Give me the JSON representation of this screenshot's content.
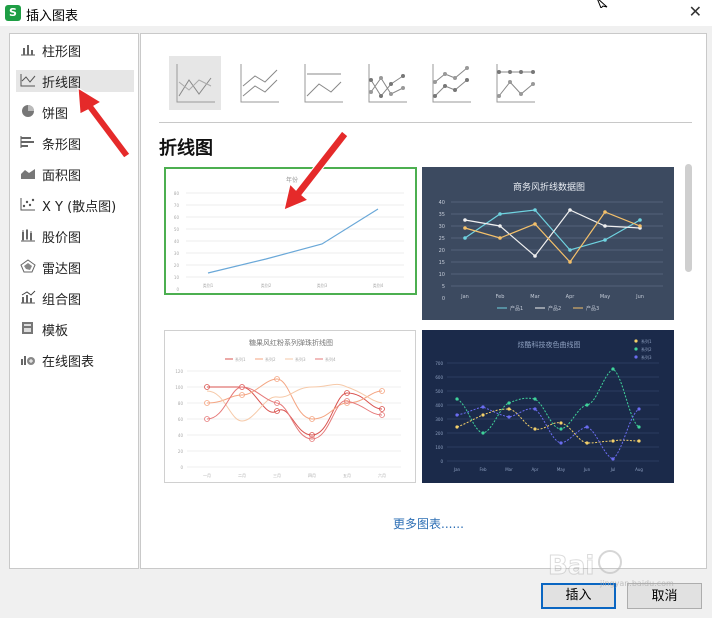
{
  "window": {
    "title": "插入图表",
    "app_icon_letter": "S"
  },
  "sidebar": {
    "items": [
      {
        "label": "柱形图",
        "icon": "column-chart-icon"
      },
      {
        "label": "折线图",
        "icon": "line-chart-icon",
        "active": true
      },
      {
        "label": "饼图",
        "icon": "pie-chart-icon"
      },
      {
        "label": "条形图",
        "icon": "bar-chart-icon"
      },
      {
        "label": "面积图",
        "icon": "area-chart-icon"
      },
      {
        "label": "X Y (散点图)",
        "icon": "scatter-chart-icon"
      },
      {
        "label": "股价图",
        "icon": "stock-chart-icon"
      },
      {
        "label": "雷达图",
        "icon": "radar-chart-icon"
      },
      {
        "label": "组合图",
        "icon": "combo-chart-icon"
      },
      {
        "label": "模板",
        "icon": "template-icon"
      },
      {
        "label": "在线图表",
        "icon": "online-chart-icon"
      }
    ]
  },
  "main": {
    "section_title": "折线图",
    "more_link": "更多图表......",
    "cards": [
      {
        "title": "年份",
        "y_ticks": [
          "80",
          "70",
          "60",
          "50",
          "40",
          "30",
          "20",
          "10",
          "0"
        ],
        "x_ticks": [
          "类别1",
          "类别2",
          "类别3",
          "类别4"
        ]
      },
      {
        "title": "商务风折线数据图",
        "y_ticks": [
          "40",
          "35",
          "30",
          "25",
          "20",
          "15",
          "10",
          "5",
          "0"
        ],
        "x_ticks": [
          "Jan",
          "Feb",
          "Mar",
          "Apr",
          "May",
          "Jun"
        ],
        "legend": [
          "产品1",
          "产品2",
          "产品3"
        ]
      },
      {
        "title": "糖果风红粉系列弹珠折线图",
        "legend": [
          "系列1",
          "系列2",
          "系列3",
          "系列4"
        ],
        "y_ticks": [
          "120",
          "100",
          "80",
          "60",
          "40",
          "20",
          "0"
        ],
        "x_ticks": [
          "一月",
          "二月",
          "三月",
          "四月",
          "五月",
          "六月"
        ]
      },
      {
        "title": "炫酷科技夜色曲线图",
        "legend": [
          "系列1",
          "系列2",
          "系列3"
        ],
        "y_ticks": [
          "700",
          "600",
          "500",
          "400",
          "300",
          "200",
          "100",
          "0"
        ],
        "x_ticks": [
          "Jan",
          "Feb",
          "Mar",
          "Apr",
          "May",
          "Jun",
          "Jul",
          "Aug"
        ]
      }
    ]
  },
  "buttons": {
    "insert": "插入",
    "cancel": "取消"
  },
  "watermark": {
    "text": "Bai",
    "subtext": "jingyan.baidu.com"
  }
}
